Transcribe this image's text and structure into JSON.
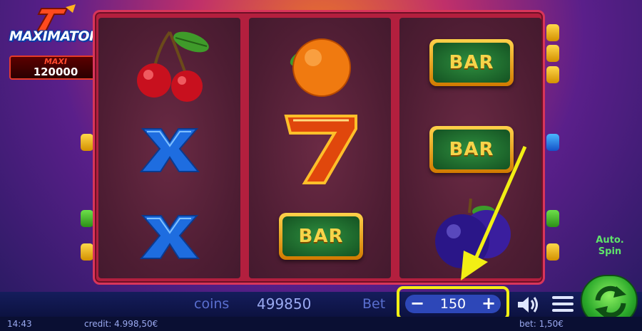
{
  "game": {
    "logo_title": "MAXIMATOR",
    "jackpot_label": "MAXI",
    "jackpot_value": "120000"
  },
  "reels": [
    [
      "cherries",
      "blue-x",
      "blue-x"
    ],
    [
      "orange",
      "seven",
      "bar"
    ],
    [
      "bar",
      "bar",
      "plum"
    ]
  ],
  "bar_text": "BAR",
  "auto_spin": {
    "line1": "Auto.",
    "line2": "Spin"
  },
  "bottom_bar": {
    "coins_label": "coins",
    "coins_value": "499850",
    "bet_label": "Bet",
    "bet_value": "150",
    "minus_label": "−",
    "plus_label": "+"
  },
  "status_bar": {
    "time": "14:43",
    "credit": "credit: 4.998,50€",
    "bet": "bet: 1,50€"
  },
  "colors": {
    "highlight": "#f2ef14",
    "reel_frame": "#b31f3e",
    "spin_button": "#2aa82a"
  },
  "icons": [
    "sound-icon",
    "menu-icon",
    "spin-icon",
    "pointer-arrow"
  ]
}
